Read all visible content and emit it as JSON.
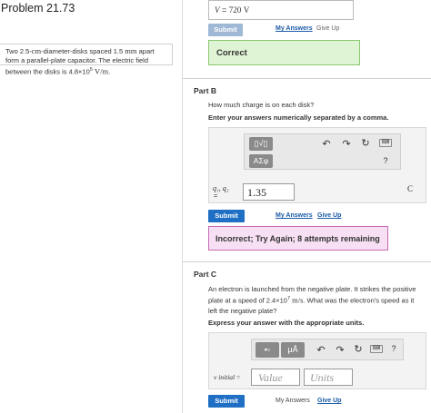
{
  "left": {
    "problem_title": "Problem 21.73",
    "problem_line1": "Two 2.5-",
    "problem_unit_cm": "cm",
    "problem_line1b": "-diameter-disks spaced 1.5",
    "problem_unit_mm": "mm",
    "problem_line1c": "apart",
    "problem_line2": "form a parallel-plate capacitor. The electric field",
    "problem_line3": "between the disks is 4.8×10",
    "problem_exp": "5",
    "problem_unit_field": "V/m",
    "problem_end": "."
  },
  "part_a": {
    "answer_var": "V",
    "answer_eq": "=",
    "answer_value": "720",
    "answer_unit": "V",
    "submit_label": "Submit",
    "my_answers_label": "My Answers",
    "give_up_label": "Give Up",
    "result_text": "Correct"
  },
  "part_b": {
    "title": "Part B",
    "question": "How much charge is on each disk?",
    "instruction": "Enter your answers numerically separated by a comma.",
    "greek_label": "ΑΣφ",
    "help_label": "?",
    "var_label": "q₁, q₂",
    "eq_label": "=",
    "input_value": "1.35",
    "unit_label": "C",
    "submit_label": "Submit",
    "my_answers_label": "My Answers",
    "give_up_label": "Give Up",
    "result_text": "Incorrect; Try Again; 8 attempts remaining"
  },
  "part_c": {
    "title": "Part C",
    "question_line1": "An electron is launched from the negative plate. It strikes the positive",
    "question_line2a": "plate at a speed of 2.4×10",
    "question_exp": "7",
    "question_unit": "m/s",
    "question_line2b": ". What was the electron's speed as it",
    "question_line3": "left the negative plate?",
    "instruction": "Express your answer with the appropriate units.",
    "units_btn_label": "μÅ",
    "help_label": "?",
    "var_label": "v initial",
    "eq_label": "=",
    "value_placeholder": "Value",
    "units_placeholder": "Units",
    "submit_label": "Submit",
    "my_answers_label": "My Answers",
    "give_up_label": "Give Up"
  },
  "colors": {
    "submit": "#1f6fc5",
    "correct_bg": "#dff4d4",
    "incorrect_bg": "#f7e0f3"
  }
}
